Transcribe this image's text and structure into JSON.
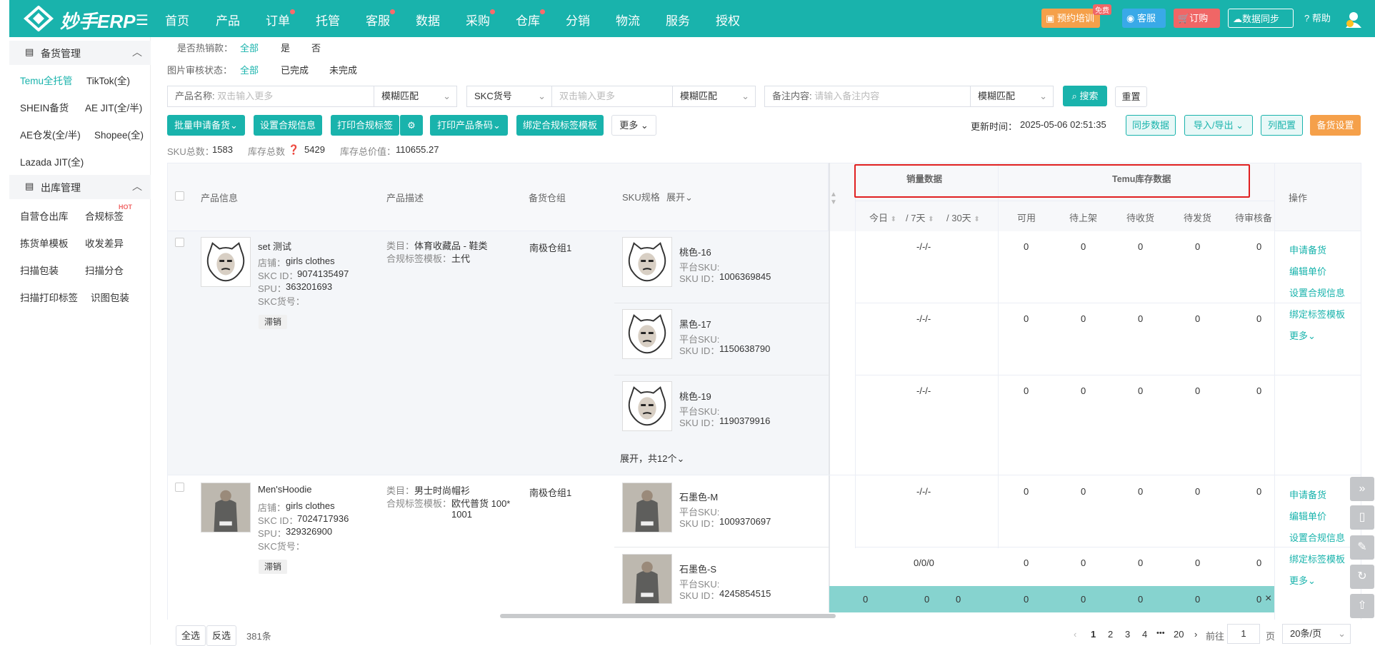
{
  "header": {
    "logo_text": "妙手ERP",
    "nav": [
      "首页",
      "产品",
      "订单",
      "托管",
      "客服",
      "数据",
      "采购",
      "仓库",
      "分销",
      "物流",
      "服务",
      "授权"
    ],
    "buttons": {
      "training": "预约培训",
      "training_badge": "免费",
      "service": "客服",
      "order": "订购",
      "sync": "数据同步",
      "help": "帮助"
    }
  },
  "sidebar": {
    "section1": "备货管理",
    "section1_items": [
      "Temu全托管",
      "TikTok(全)",
      "SHEIN备货",
      "AE JIT(全/半)",
      "AE仓发(全/半)",
      "Shopee(全)",
      "Lazada JIT(全)"
    ],
    "section2": "出库管理",
    "section2_items": [
      "自营仓出库",
      "合规标签",
      "拣货单模板",
      "收发差异",
      "扫描包装",
      "扫描分仓",
      "扫描打印标签",
      "识图包装"
    ],
    "hot_badge": "HOT"
  },
  "filters": {
    "hot_label": "是否热销款：",
    "hot_options": [
      "全部",
      "是",
      "否"
    ],
    "audit_label": "图片审核状态：",
    "audit_options": [
      "全部",
      "已完成",
      "未完成"
    ],
    "product_name_label": "产品名称:",
    "product_name_placeholder": "双击输入更多",
    "fuzzy1": "模糊匹配",
    "skc_label": "SKC货号",
    "skc_placeholder": "双击输入更多",
    "fuzzy2": "模糊匹配",
    "note_label": "备注内容:",
    "note_placeholder": "请输入备注内容",
    "fuzzy3": "模糊匹配",
    "search": "搜索",
    "reset": "重置"
  },
  "toolbar": {
    "batch_apply": "批量申请备货",
    "set_compliance": "设置合规信息",
    "print_compliance": "打印合规标签",
    "print_barcode": "打印产品条码",
    "bind_template": "绑定合规标签模板",
    "more": "更多",
    "update_time_label": "更新时间：",
    "update_time": "2025-05-06 02:51:35",
    "sync_data": "同步数据",
    "import_export": "导入/导出",
    "column_config": "列配置",
    "stock_settings": "备货设置"
  },
  "stats": {
    "sku_label": "SKU总数：",
    "sku_total": "1583",
    "stock_label": "库存总数",
    "stock_total": "5429",
    "value_label": "库存总价值：",
    "value_total": "110655.27"
  },
  "table": {
    "headers": {
      "product_info": "产品信息",
      "description": "产品描述",
      "warehouse": "备货仓组",
      "sku_spec": "SKU规格",
      "expand": "展开",
      "sales_group": "销量数据",
      "stock_group": "Temu库存数据",
      "today": "今日",
      "d7": "/ 7天",
      "d30": "/ 30天",
      "available": "可用",
      "pending_shelf": "待上架",
      "pending_receive": "待收货",
      "pending_ship": "待发货",
      "pending_audit": "待审核备",
      "ops": "操作"
    },
    "rows": [
      {
        "title": "set 测试",
        "shop_label": "店铺：",
        "shop": "girls clothes",
        "skc_label": "SKC ID：",
        "skc": "9074135497",
        "spu_label": "SPU：",
        "spu": "363201693",
        "skc_no_label": "SKC货号：",
        "tag": "滞销",
        "cat_label": "类目：",
        "category": "体育收藏品 - 鞋类",
        "tpl_label": "合规标签模板：",
        "template": "土代",
        "warehouse": "南极仓组1",
        "skus": [
          {
            "name": "桃色-16",
            "platform_sku": "平台SKU:",
            "sku_id_label": "SKU ID：",
            "sku_id": "1006369845",
            "sales": "-/-/-",
            "v": [
              "0",
              "0",
              "0",
              "0",
              "0"
            ]
          },
          {
            "name": "黑色-17",
            "platform_sku": "平台SKU:",
            "sku_id_label": "SKU ID：",
            "sku_id": "1150638790",
            "sales": "-/-/-",
            "v": [
              "0",
              "0",
              "0",
              "0",
              "0"
            ]
          },
          {
            "name": "桃色-19",
            "platform_sku": "平台SKU:",
            "sku_id_label": "SKU ID：",
            "sku_id": "1190379916",
            "sales": "-/-/-",
            "v": [
              "0",
              "0",
              "0",
              "0",
              "0"
            ]
          }
        ],
        "expand_more": "展开，共12个",
        "ops": [
          "申请备货",
          "编辑单价",
          "设置合规信息",
          "绑定标签模板",
          "更多"
        ]
      },
      {
        "title": "Men'sHoodie",
        "shop_label": "店铺：",
        "shop": "girls clothes",
        "skc_label": "SKC ID：",
        "skc": "7024717936",
        "spu_label": "SPU：",
        "spu": "329326900",
        "skc_no_label": "SKC货号：",
        "tag": "滞销",
        "cat_label": "类目：",
        "category": "男士时尚帽衫",
        "tpl_label": "合规标签模板：",
        "template": "欧代普货 100*",
        "template2": "1001",
        "warehouse": "南极仓组1",
        "skus": [
          {
            "name": "石墨色-M",
            "platform_sku": "平台SKU:",
            "sku_id_label": "SKU ID：",
            "sku_id": "1009370697",
            "sales": "-/-/-",
            "v": [
              "0",
              "0",
              "0",
              "0",
              "0"
            ]
          },
          {
            "name": "石墨色-S",
            "platform_sku": "平台SKU:",
            "sku_id_label": "SKU ID：",
            "sku_id": "4245854515",
            "sales": "0/0/0",
            "v": [
              "0",
              "0",
              "0",
              "0",
              "0"
            ]
          }
        ],
        "ops": [
          "申请备货",
          "编辑单价",
          "设置合规信息",
          "绑定标签模板",
          "更多"
        ]
      }
    ],
    "summary": [
      "0",
      "0",
      "0",
      "0",
      "0",
      "0",
      "0",
      "0"
    ]
  },
  "footer": {
    "select_all": "全选",
    "invert": "反选",
    "count": "381条",
    "pages": [
      "1",
      "2",
      "3",
      "4",
      "20"
    ],
    "ellipsis": "•••",
    "goto": "前往",
    "page_input": "1",
    "page_unit": "页",
    "page_size": "20条/页"
  },
  "colors": {
    "primary": "#19b3ac",
    "highlight_border": "#e02020",
    "orange": "#f5a04a",
    "red": "#f06666"
  }
}
